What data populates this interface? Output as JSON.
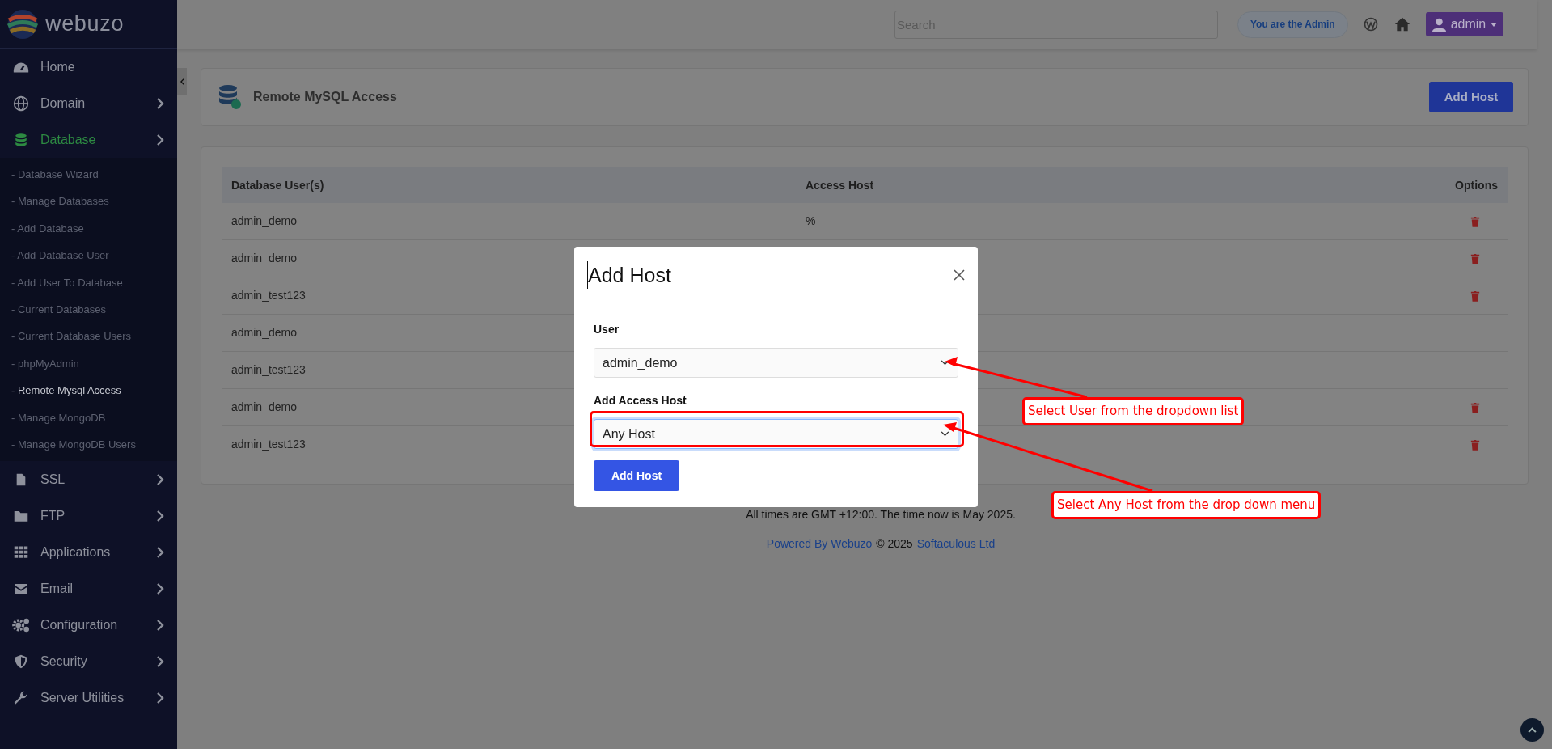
{
  "sidebar": {
    "logo": "webuzo",
    "items": [
      {
        "label": "Home",
        "kind": "link",
        "selected": false
      },
      {
        "label": "Domain",
        "kind": "menu",
        "selected": false
      },
      {
        "label": "Database",
        "kind": "menu",
        "selected": true,
        "expanded": true,
        "children": [
          {
            "label": "- Database Wizard",
            "selected": false
          },
          {
            "label": "- Manage Databases",
            "selected": false
          },
          {
            "label": "- Add Database",
            "selected": false
          },
          {
            "label": "- Add Database User",
            "selected": false
          },
          {
            "label": "- Add User To Database",
            "selected": false
          },
          {
            "label": "- Current Databases",
            "selected": false
          },
          {
            "label": "- Current Database Users",
            "selected": false
          },
          {
            "label": "- phpMyAdmin",
            "selected": false
          },
          {
            "label": "- Remote Mysql Access",
            "selected": true
          },
          {
            "label": "- Manage MongoDB",
            "selected": false
          },
          {
            "label": "- Manage MongoDB Users",
            "selected": false
          }
        ]
      },
      {
        "label": "SSL",
        "kind": "menu",
        "selected": false
      },
      {
        "label": "FTP",
        "kind": "menu",
        "selected": false
      },
      {
        "label": "Applications",
        "kind": "menu",
        "selected": false
      },
      {
        "label": "Email",
        "kind": "menu",
        "selected": false
      },
      {
        "label": "Configuration",
        "kind": "menu",
        "selected": false
      },
      {
        "label": "Security",
        "kind": "menu",
        "selected": false
      },
      {
        "label": "Server Utilities",
        "kind": "menu",
        "selected": false
      }
    ]
  },
  "topbar": {
    "search": {
      "placeholder": "Search"
    },
    "admin_badge": "You are the Admin",
    "user_menu": "admin"
  },
  "page": {
    "title": "Remote MySQL Access",
    "add_button": "Add Host"
  },
  "table": {
    "columns": [
      "Database User(s)",
      "Access Host",
      "Options"
    ],
    "rows": [
      {
        "user": "admin_demo",
        "access_host": "%",
        "deletable": true
      },
      {
        "user": "admin_demo",
        "deletable": true
      },
      {
        "user": "admin_test123",
        "deletable": true
      },
      {
        "user": "admin_demo",
        "deletable": false
      },
      {
        "user": "admin_test123",
        "deletable": false
      },
      {
        "user": "admin_demo",
        "deletable": true
      },
      {
        "user": "admin_test123",
        "deletable": true
      }
    ]
  },
  "footer": {
    "timezone": "All times are GMT +12:00. The time now is May 2025.",
    "powered_by": "Powered By Webuzo",
    "copyright": "© 2025",
    "company": "Softaculous Ltd"
  },
  "modal": {
    "title": "Add Host",
    "fields": [
      {
        "label": "User",
        "value": "admin_demo",
        "focused": false
      },
      {
        "label": "Add Access Host",
        "value": "Any Host",
        "focused": true
      }
    ],
    "submit": "Add Host"
  },
  "annotations": [
    "Select User from the dropdown list",
    "Select Any Host from the drop down menu"
  ]
}
